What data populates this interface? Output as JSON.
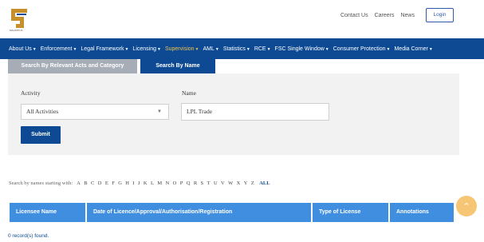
{
  "header": {
    "logo_caption": "MAURITIUS",
    "links": [
      "Contact Us",
      "Careers",
      "News"
    ],
    "login_label": "Login"
  },
  "nav": {
    "items": [
      {
        "label": "About Us",
        "active": false
      },
      {
        "label": "Enforcement",
        "active": false
      },
      {
        "label": "Legal Framework",
        "active": false
      },
      {
        "label": "Licensing",
        "active": false
      },
      {
        "label": "Supervision",
        "active": true
      },
      {
        "label": "AML",
        "active": false
      },
      {
        "label": "Statistics",
        "active": false
      },
      {
        "label": "RCE",
        "active": false
      },
      {
        "label": "FSC Single Window",
        "active": false
      },
      {
        "label": "Consumer Protection",
        "active": false
      },
      {
        "label": "Media Corner",
        "active": false
      }
    ]
  },
  "tabs": {
    "acts": "Search By Relevant Acts and Category",
    "name": "Search By Name"
  },
  "form": {
    "activity_label": "Activity",
    "activity_value": "All Activities",
    "name_label": "Name",
    "name_value": "LPL Trade",
    "submit_label": "Submit"
  },
  "alphabet": {
    "prefix": "Search by names starting with:",
    "letters": [
      "A",
      "B",
      "C",
      "D",
      "E",
      "F",
      "G",
      "H",
      "I",
      "J",
      "K",
      "L",
      "M",
      "N",
      "O",
      "P",
      "Q",
      "R",
      "S",
      "T",
      "U",
      "V",
      "W",
      "X",
      "Y",
      "Z"
    ],
    "all_label": "ALL"
  },
  "table": {
    "columns": [
      "Licensee Name",
      "Date of Licence/Approval/Authorisation/Registration",
      "Type of License",
      "Annotations"
    ]
  },
  "records_text": "0 record(s) found.",
  "colors": {
    "primary": "#0d4a93",
    "table_header": "#3f8ee0",
    "active_nav": "#f0c24a",
    "scroll_button": "#f7c674"
  },
  "icons": {
    "scroll_top": "chevron-up-icon"
  }
}
